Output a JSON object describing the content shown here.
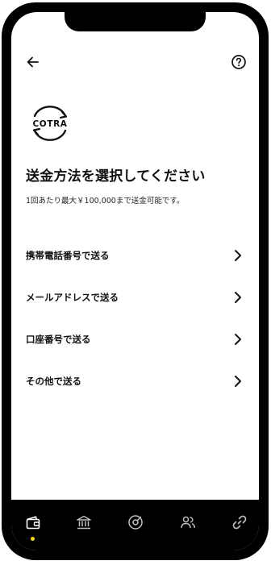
{
  "header": {
    "back_icon": "arrow-left-icon",
    "help_icon": "question-circle-icon"
  },
  "logo": {
    "text": "COTRA"
  },
  "title": "送金方法を選択してください",
  "subtitle": "1回あたり最大￥100,000まで送金可能です。",
  "methods": [
    {
      "label": "携帯電話番号で送る",
      "icon": "chevron-right-icon"
    },
    {
      "label": "メールアドレスで送る",
      "icon": "chevron-right-icon"
    },
    {
      "label": "口座番号で送る",
      "icon": "chevron-right-icon"
    },
    {
      "label": "その他で送る",
      "icon": "chevron-right-icon"
    }
  ],
  "tabbar": {
    "tabs": [
      {
        "icon": "wallet-icon",
        "active": true
      },
      {
        "icon": "bank-icon",
        "active": false
      },
      {
        "icon": "target-icon",
        "active": false
      },
      {
        "icon": "people-icon",
        "active": false
      },
      {
        "icon": "link-icon",
        "active": false
      }
    ],
    "active_indicator_color": "#f5d90a",
    "icon_color": "#bfbfbf"
  }
}
